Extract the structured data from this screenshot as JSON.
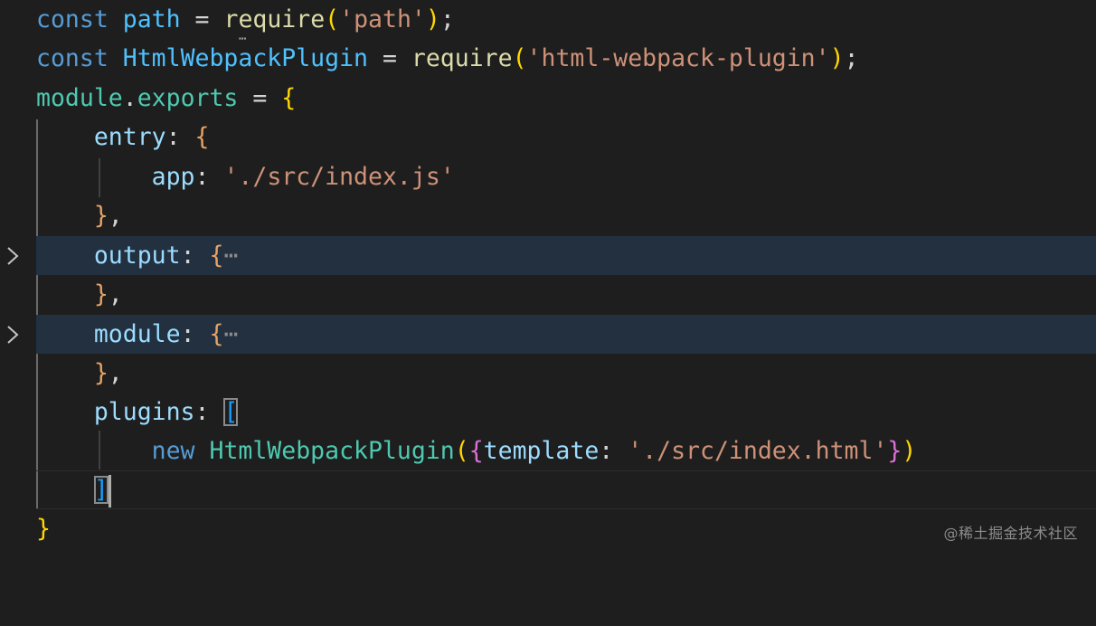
{
  "editor": {
    "line1": {
      "kw": "const",
      "name": "path",
      "op": "=",
      "fn": "require",
      "open": "(",
      "arg": "'path'",
      "close": ")",
      "end": ";"
    },
    "line2": {
      "kw": "const",
      "name": "HtmlWebpackPlugin",
      "op": "=",
      "fn": "require",
      "open": "(",
      "arg": "'html-webpack-plugin'",
      "close": ")",
      "end": ";"
    },
    "line3": {
      "obj": "module",
      "dot": ".",
      "prop": "exports",
      "op": "=",
      "brace": "{"
    },
    "line4": {
      "key": "entry",
      "colon": ":",
      "brace": "{"
    },
    "line5": {
      "key": "app",
      "colon": ":",
      "value": "'./src/index.js'"
    },
    "line6": {
      "close": "}",
      "comma": ","
    },
    "line7": {
      "key": "output",
      "colon": ":",
      "brace": "{",
      "ellipsis": "⋯"
    },
    "line8": {
      "close": "}",
      "comma": ","
    },
    "line9": {
      "key": "module",
      "colon": ":",
      "brace": "{",
      "ellipsis": "⋯"
    },
    "line10": {
      "close": "}",
      "comma": ","
    },
    "line11": {
      "key": "plugins",
      "colon": ":",
      "bracket": "["
    },
    "line12": {
      "kw": "new",
      "cls": "HtmlWebpackPlugin",
      "open": "(",
      "brace_open": "{",
      "key": "template",
      "colon": ":",
      "value": "'./src/index.html'",
      "brace_close": "}",
      "close": ")"
    },
    "line13": {
      "bracket": "]"
    },
    "line14": {
      "brace": "}"
    },
    "hint": "⋯"
  },
  "icons": {
    "fold": "chevron-right-icon"
  },
  "watermark": "@稀土掘金技术社区",
  "colors": {
    "background": "#1e1e1e",
    "folded_highlight": "#223040",
    "keyword": "#569cd6",
    "string": "#ce9178",
    "function": "#dcdcaa",
    "class": "#4ec9b0",
    "property": "#9cdcfe"
  }
}
